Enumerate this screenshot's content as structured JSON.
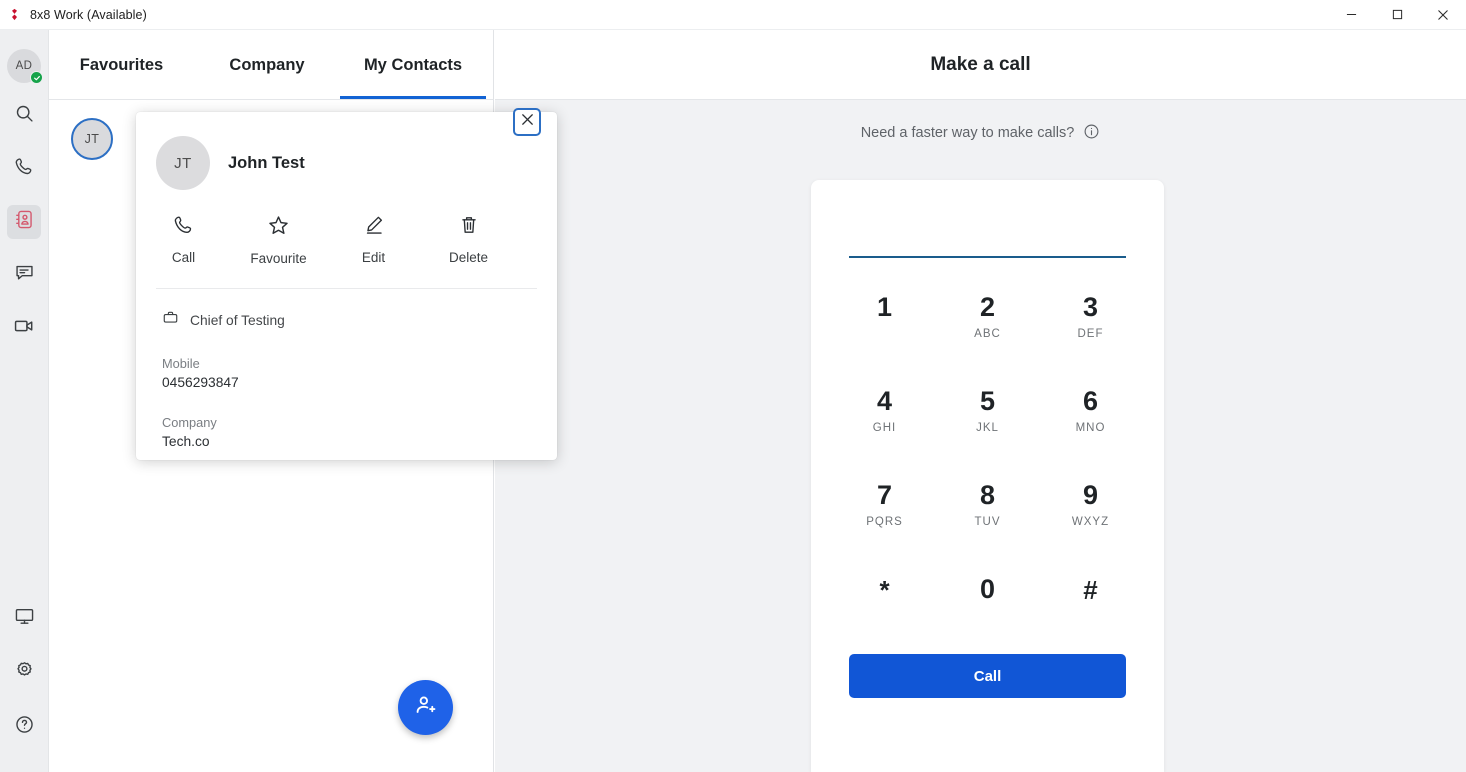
{
  "window": {
    "title": "8x8 Work (Available)",
    "logo_icon": "8x8-logo-icon",
    "minimize_label": "–",
    "maximize_label": "□",
    "close_label": "✕"
  },
  "sidebar": {
    "avatar": {
      "initials": "AD",
      "status": "available",
      "status_color": "#16a34a"
    },
    "items": [
      {
        "icon": "search-icon",
        "name": "search"
      },
      {
        "icon": "phone-icon",
        "name": "calls"
      },
      {
        "icon": "contacts-book-icon",
        "name": "contacts",
        "active": true
      },
      {
        "icon": "chat-bubble-icon",
        "name": "messages"
      },
      {
        "icon": "video-camera-icon",
        "name": "meetings"
      }
    ],
    "bottom_items": [
      {
        "icon": "monitor-icon",
        "name": "devices"
      },
      {
        "icon": "gear-icon",
        "name": "settings"
      },
      {
        "icon": "help-circle-icon",
        "name": "help"
      }
    ],
    "active_color": "#d4596e"
  },
  "contacts": {
    "tabs": [
      {
        "label": "Favourites",
        "active": false
      },
      {
        "label": "Company",
        "active": false
      },
      {
        "label": "My Contacts",
        "active": true
      }
    ],
    "active_tab_color": "#1263d4",
    "list": [
      {
        "initials": "JT",
        "selected": true
      }
    ],
    "add_contact_icon": "add-person-icon"
  },
  "contact_card": {
    "avatar_initials": "JT",
    "name": "John Test",
    "close_icon": "close-icon",
    "actions": [
      {
        "label": "Call",
        "icon": "phone-icon"
      },
      {
        "label": "Favourite",
        "icon": "star-icon"
      },
      {
        "label": "Edit",
        "icon": "pencil-icon"
      },
      {
        "label": "Delete",
        "icon": "trash-icon"
      }
    ],
    "job_icon": "briefcase-icon",
    "job_title": "Chief of Testing",
    "fields": [
      {
        "label": "Mobile",
        "value": "0456293847"
      },
      {
        "label": "Company",
        "value": "Tech.co"
      }
    ]
  },
  "call_panel": {
    "title": "Make a call",
    "hint_text": "Need a faster way to make calls?",
    "hint_icon": "info-circle-icon",
    "input_value": "",
    "input_placeholder": "",
    "keys": [
      {
        "digit": "1",
        "letters": ""
      },
      {
        "digit": "2",
        "letters": "ABC"
      },
      {
        "digit": "3",
        "letters": "DEF"
      },
      {
        "digit": "4",
        "letters": "GHI"
      },
      {
        "digit": "5",
        "letters": "JKL"
      },
      {
        "digit": "6",
        "letters": "MNO"
      },
      {
        "digit": "7",
        "letters": "PQRS"
      },
      {
        "digit": "8",
        "letters": "TUV"
      },
      {
        "digit": "9",
        "letters": "WXYZ"
      },
      {
        "digit": "*",
        "letters": ""
      },
      {
        "digit": "0",
        "letters": ""
      },
      {
        "digit": "#",
        "letters": ""
      }
    ],
    "call_button_label": "Call",
    "call_button_color": "#1156d6"
  }
}
